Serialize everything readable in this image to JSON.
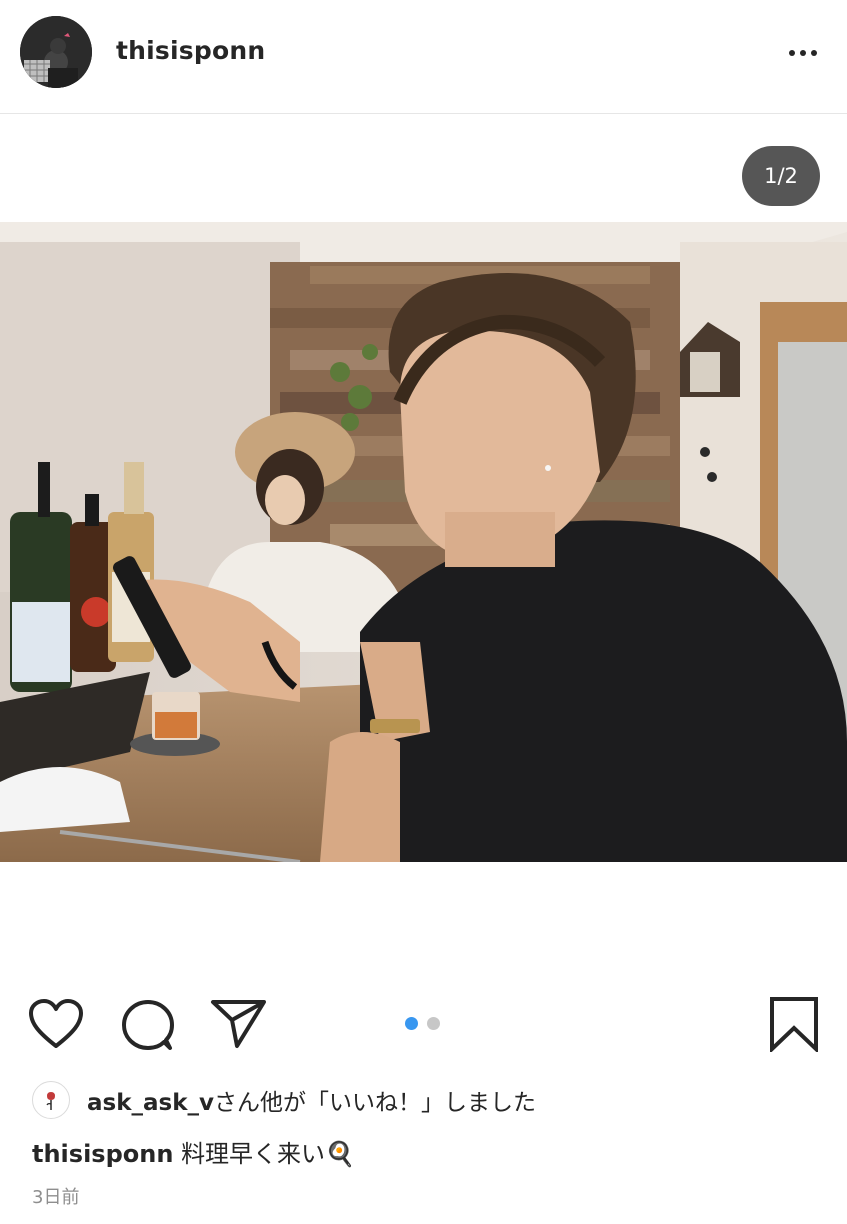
{
  "post": {
    "username": "thisisponn",
    "image_counter": "1/2",
    "carousel": {
      "count": 2,
      "active": 0
    },
    "liked_by_user": "ask_ask_v",
    "liked_by_suffix": "さん他が「いいね！」しました",
    "caption_user": "thisisponn",
    "caption_text": "料理早く来い🍳",
    "timestamp": "3日前"
  },
  "icons": {
    "more": "more-options-icon",
    "like": "heart-icon",
    "comment": "comment-icon",
    "share": "send-icon",
    "save": "bookmark-icon"
  },
  "colors": {
    "text": "#262626",
    "secondary_text": "#8e8e8e",
    "dot_active": "#3897f0",
    "dot_inactive": "#c7c7c7",
    "counter_bg": "#444444"
  }
}
